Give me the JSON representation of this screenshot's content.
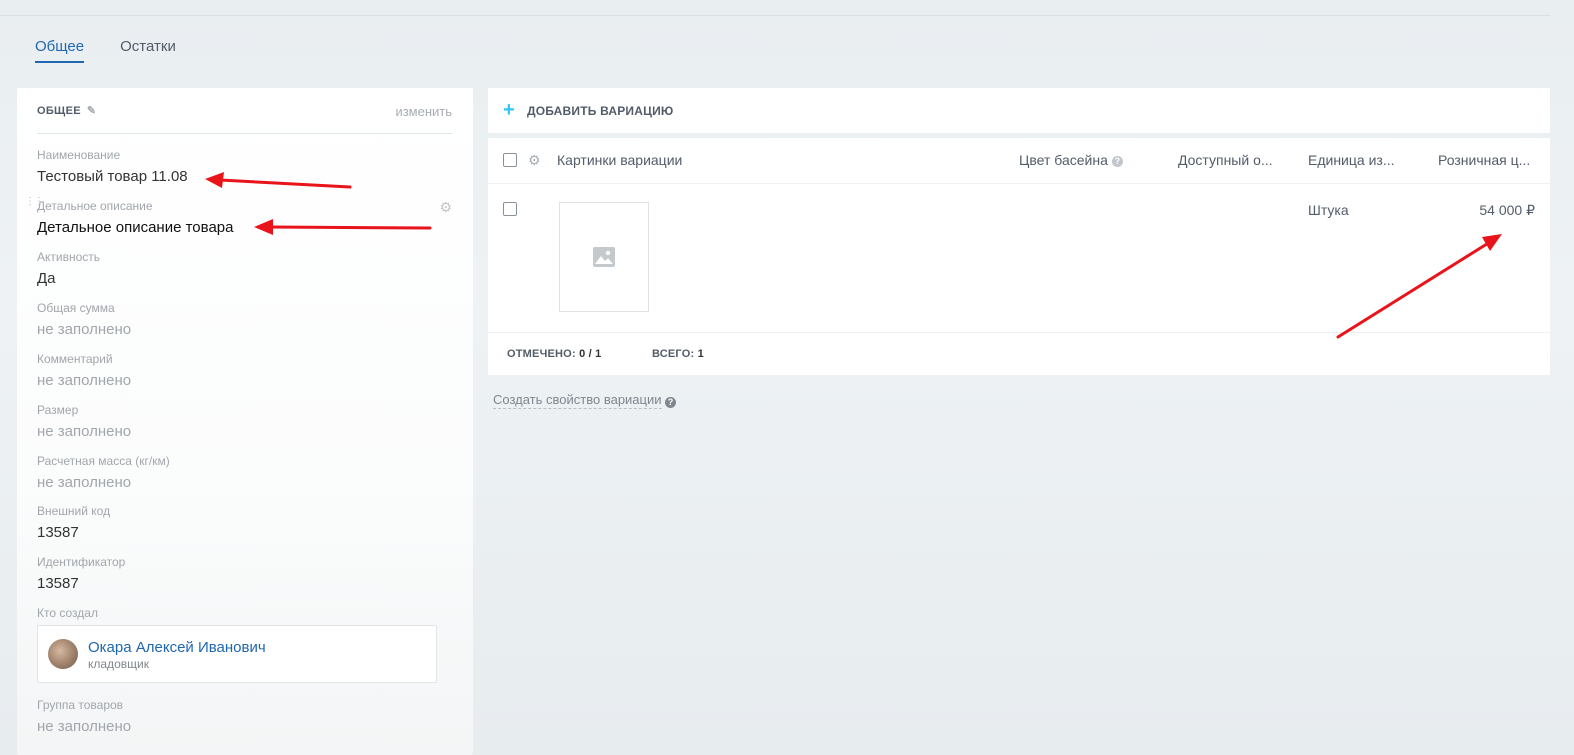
{
  "tabs": [
    {
      "label": "Общее",
      "active": true
    },
    {
      "label": "Остатки",
      "active": false
    }
  ],
  "left_panel": {
    "title": "ОБЩЕЕ",
    "edit_label": "изменить",
    "fields": [
      {
        "label": "Наименование",
        "value": "Тестовый товар 11.08",
        "empty": false
      },
      {
        "label": "Детальное описание",
        "value": "Детальное описание товара",
        "empty": false
      },
      {
        "label": "Активность",
        "value": "Да",
        "empty": false
      },
      {
        "label": "Общая сумма",
        "value": "не заполнено",
        "empty": true
      },
      {
        "label": "Комментарий",
        "value": "не заполнено",
        "empty": true
      },
      {
        "label": "Размер",
        "value": "не заполнено",
        "empty": true
      },
      {
        "label": "Расчетная масса (кг/км)",
        "value": "не заполнено",
        "empty": true
      },
      {
        "label": "Внешний код",
        "value": "13587",
        "empty": false
      },
      {
        "label": "Идентификатор",
        "value": "13587",
        "empty": false
      },
      {
        "label": "Кто создал",
        "value": "",
        "empty": false
      },
      {
        "label": "Группа товаров",
        "value": "не заполнено",
        "empty": true
      }
    ],
    "creator": {
      "name": "Окара Алексей Иванович",
      "role": "кладовщик"
    }
  },
  "variations": {
    "add_label": "ДОБАВИТЬ ВАРИАЦИЮ",
    "columns": [
      "Картинки вариации",
      "Цвет басейна",
      "Доступный о...",
      "Единица из...",
      "Розничная ц..."
    ],
    "rows": [
      {
        "unit": "Штука",
        "price": "54 000 ₽"
      }
    ],
    "footer": {
      "checked_label": "ОТМЕЧЕНО:",
      "checked_value": "0 / 1",
      "total_label": "ВСЕГО:",
      "total_value": "1"
    },
    "create_property_label": "Создать свойство вариации",
    "help_glyph": "?"
  },
  "colors": {
    "accent": "#2067b0",
    "plus": "#2fc6f6",
    "annotation": "#e8141a"
  }
}
